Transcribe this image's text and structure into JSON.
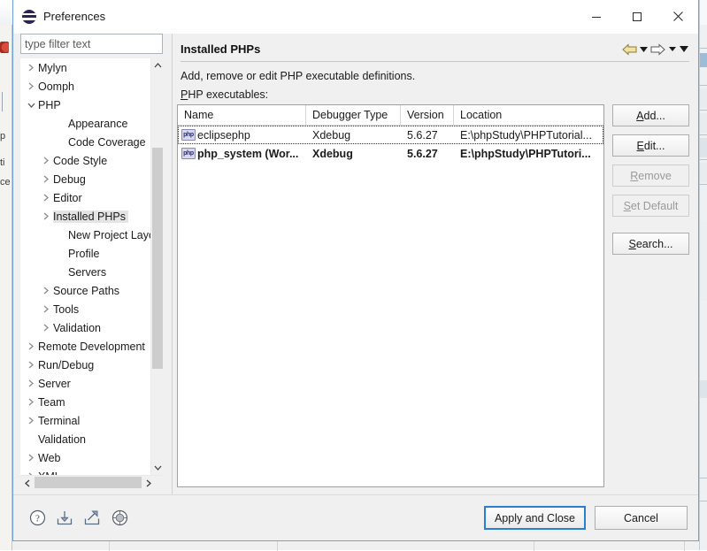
{
  "window": {
    "title": "Preferences",
    "icon": "eclipse-icon",
    "controls": {
      "minimize": "minimize-icon",
      "maximize": "maximize-icon",
      "close": "close-icon"
    }
  },
  "filter": {
    "placeholder": "type filter text",
    "value": ""
  },
  "tree": {
    "items": [
      {
        "label": "Mylyn",
        "level": 0,
        "arrow": "collapsed",
        "selected": false
      },
      {
        "label": "Oomph",
        "level": 0,
        "arrow": "collapsed",
        "selected": false
      },
      {
        "label": "PHP",
        "level": 0,
        "arrow": "expanded",
        "selected": false
      },
      {
        "label": "Appearance",
        "level": 2,
        "arrow": "none",
        "selected": false
      },
      {
        "label": "Code Coverage",
        "level": 2,
        "arrow": "none",
        "selected": false
      },
      {
        "label": "Code Style",
        "level": 1,
        "arrow": "collapsed",
        "selected": false
      },
      {
        "label": "Debug",
        "level": 1,
        "arrow": "collapsed",
        "selected": false
      },
      {
        "label": "Editor",
        "level": 1,
        "arrow": "collapsed",
        "selected": false
      },
      {
        "label": "Installed PHPs",
        "level": 1,
        "arrow": "collapsed",
        "selected": true
      },
      {
        "label": "New Project Layout",
        "level": 2,
        "arrow": "none",
        "selected": false
      },
      {
        "label": "Profile",
        "level": 2,
        "arrow": "none",
        "selected": false
      },
      {
        "label": "Servers",
        "level": 2,
        "arrow": "none",
        "selected": false
      },
      {
        "label": "Source Paths",
        "level": 1,
        "arrow": "collapsed",
        "selected": false
      },
      {
        "label": "Tools",
        "level": 1,
        "arrow": "collapsed",
        "selected": false
      },
      {
        "label": "Validation",
        "level": 1,
        "arrow": "collapsed",
        "selected": false
      },
      {
        "label": "Remote Development",
        "level": 0,
        "arrow": "collapsed",
        "selected": false
      },
      {
        "label": "Run/Debug",
        "level": 0,
        "arrow": "collapsed",
        "selected": false
      },
      {
        "label": "Server",
        "level": 0,
        "arrow": "collapsed",
        "selected": false
      },
      {
        "label": "Team",
        "level": 0,
        "arrow": "collapsed",
        "selected": false
      },
      {
        "label": "Terminal",
        "level": 0,
        "arrow": "collapsed",
        "selected": false
      },
      {
        "label": "Validation",
        "level": 0,
        "arrow": "none",
        "selected": false
      },
      {
        "label": "Web",
        "level": 0,
        "arrow": "collapsed",
        "selected": false
      },
      {
        "label": "XML",
        "level": 0,
        "arrow": "collapsed",
        "selected": false
      }
    ]
  },
  "page": {
    "title": "Installed PHPs",
    "description": "Add, remove or edit PHP executable definitions.",
    "table_label": "PHP executables:",
    "nav": {
      "back": "back-arrow-icon",
      "back_menu": "chevron-down-icon",
      "forward": "forward-arrow-icon",
      "forward_menu": "chevron-down-icon",
      "view_menu": "chevron-down-icon"
    }
  },
  "table": {
    "columns": [
      "Name",
      "Debugger Type",
      "Version",
      "Location"
    ],
    "rows": [
      {
        "icon": "php-icon",
        "name": "eclipsephp",
        "debugger": "Xdebug",
        "version": "5.6.27",
        "location": "E:\\phpStudy\\PHPTutorial...",
        "bold": false,
        "focused": true
      },
      {
        "icon": "php-icon",
        "name": "php_system (Wor...",
        "debugger": "Xdebug",
        "version": "5.6.27",
        "location": "E:\\phpStudy\\PHPTutori...",
        "bold": true,
        "focused": false
      }
    ]
  },
  "side_buttons": [
    {
      "label": "Add...",
      "underline": "A",
      "enabled": true
    },
    {
      "label": "Edit...",
      "underline": "E",
      "enabled": true
    },
    {
      "label": "Remove",
      "underline": "R",
      "enabled": false
    },
    {
      "label": "Set Default",
      "underline": "S",
      "enabled": false
    },
    {
      "label": "Search...",
      "underline": "S",
      "enabled": true
    }
  ],
  "footer": {
    "icons": [
      "help-icon",
      "import-icon",
      "export-icon",
      "restore-defaults-icon"
    ],
    "apply_and_close": "Apply and Close",
    "cancel": "Cancel"
  },
  "colors": {
    "accent": "#2a7fd4",
    "dialog_bg": "#f0f0f0",
    "selection": "#e4e4e4",
    "php_icon": "#d7d7ef"
  }
}
